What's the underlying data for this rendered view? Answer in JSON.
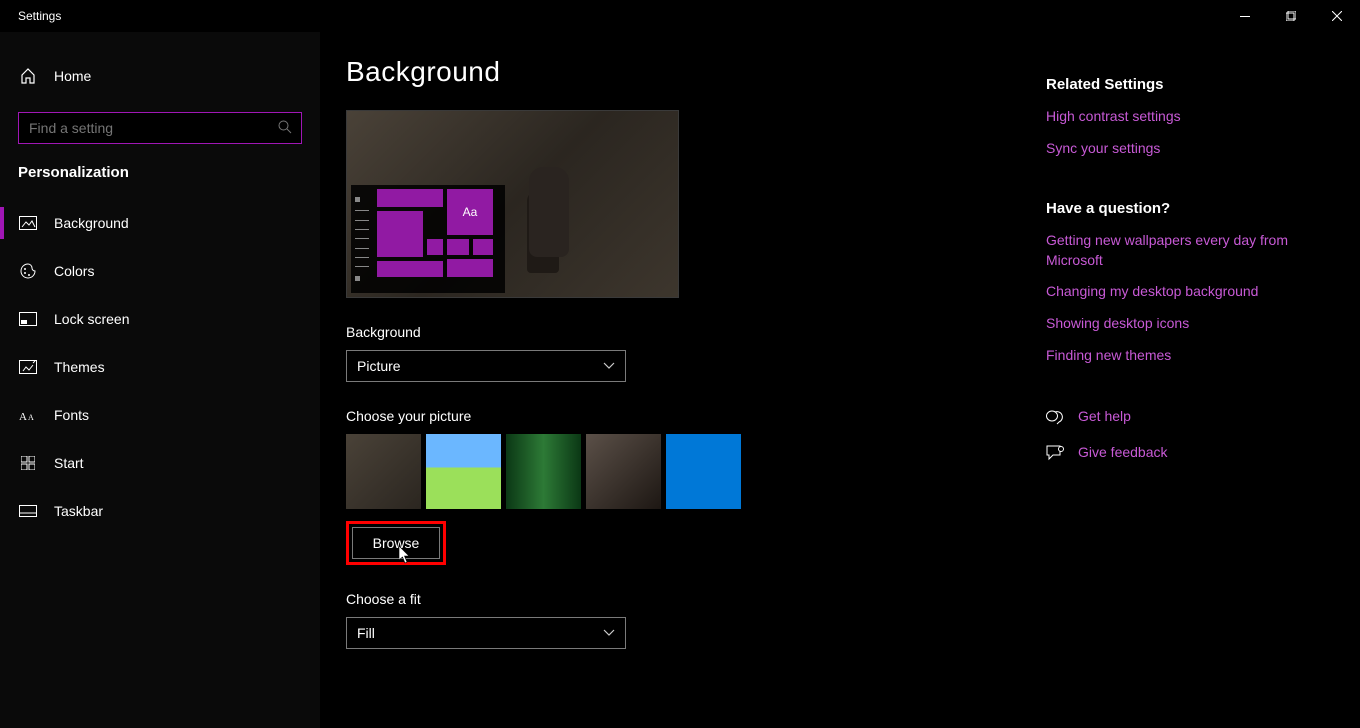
{
  "window": {
    "title": "Settings"
  },
  "sidebar": {
    "home": "Home",
    "search_placeholder": "Find a setting",
    "section": "Personalization",
    "items": [
      {
        "label": "Background",
        "active": true
      },
      {
        "label": "Colors"
      },
      {
        "label": "Lock screen"
      },
      {
        "label": "Themes"
      },
      {
        "label": "Fonts"
      },
      {
        "label": "Start"
      },
      {
        "label": "Taskbar"
      }
    ]
  },
  "main": {
    "heading": "Background",
    "preview_tile_text": "Aa",
    "bg_label": "Background",
    "bg_value": "Picture",
    "choose_picture_label": "Choose your picture",
    "browse_label": "Browse",
    "fit_label": "Choose a fit",
    "fit_value": "Fill"
  },
  "right": {
    "related_heading": "Related Settings",
    "related_links": [
      "High contrast settings",
      "Sync your settings"
    ],
    "question_heading": "Have a question?",
    "question_links": [
      "Getting new wallpapers every day from Microsoft",
      "Changing my desktop background",
      "Showing desktop icons",
      "Finding new themes"
    ],
    "help": "Get help",
    "feedback": "Give feedback"
  }
}
